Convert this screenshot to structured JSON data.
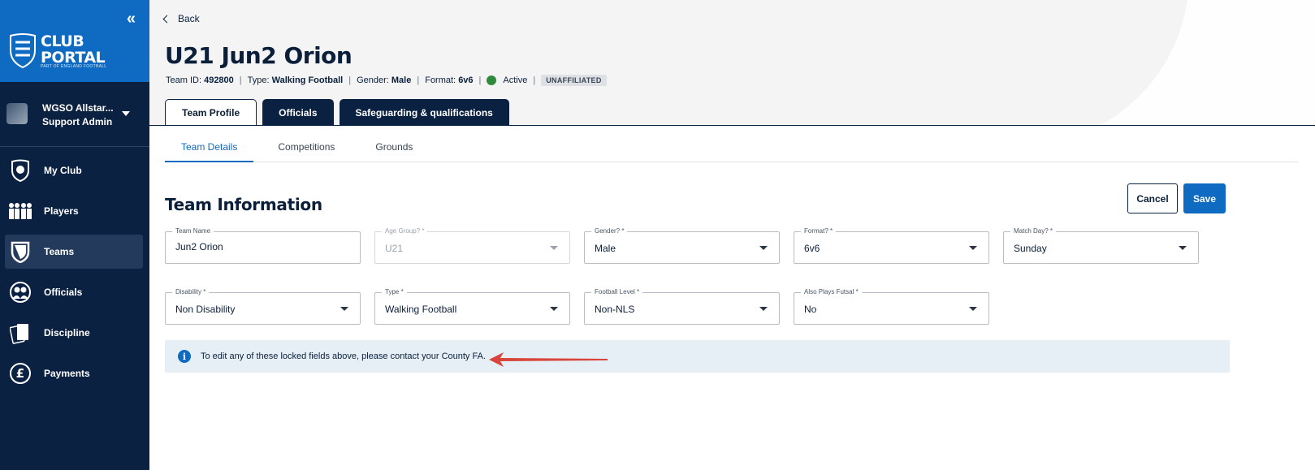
{
  "sidebar": {
    "collapse_icon": "double-chevron-left-icon",
    "brand": {
      "line1": "CLUB",
      "line2": "PORTAL",
      "sub": "PART OF ENGLAND FOOTBALL",
      "logo_icon": "three-lions-crest-icon"
    },
    "user": {
      "name": "WGSO Allstar...",
      "role": "Support Admin",
      "dropdown_icon": "caret-down-icon"
    },
    "nav": [
      {
        "label": "My Club",
        "icon": "club-badge-icon"
      },
      {
        "label": "Players",
        "icon": "players-group-icon"
      },
      {
        "label": "Teams",
        "icon": "shield-icon"
      },
      {
        "label": "Officials",
        "icon": "officials-icon"
      },
      {
        "label": "Discipline",
        "icon": "cards-icon"
      },
      {
        "label": "Payments",
        "icon": "pound-icon"
      }
    ],
    "active_nav": "Teams"
  },
  "header": {
    "back_label": "Back",
    "title": "U21 Jun2 Orion",
    "meta": {
      "team_id_label": "Team ID:",
      "team_id": "492800",
      "type_label": "Type:",
      "type": "Walking Football",
      "gender_label": "Gender:",
      "gender": "Male",
      "format_label": "Format:",
      "format": "6v6",
      "status": "Active",
      "status_color": "#2f8b3b",
      "affiliation": "UNAFFILIATED"
    },
    "tabs": [
      {
        "label": "Team Profile",
        "active": true
      },
      {
        "label": "Officials",
        "active": false
      },
      {
        "label": "Safeguarding & qualifications",
        "active": false
      }
    ]
  },
  "subtabs": [
    {
      "label": "Team Details",
      "active": true
    },
    {
      "label": "Competitions",
      "active": false
    },
    {
      "label": "Grounds",
      "active": false
    }
  ],
  "form": {
    "section_title": "Team Information",
    "cancel_label": "Cancel",
    "save_label": "Save",
    "fields": {
      "team_name": {
        "label": "Team Name",
        "value": "Jun2 Orion"
      },
      "age_group": {
        "label": "Age Group? *",
        "value": "U21"
      },
      "gender": {
        "label": "Gender? *",
        "value": "Male"
      },
      "format": {
        "label": "Format? *",
        "value": "6v6"
      },
      "match_day": {
        "label": "Match Day? *",
        "value": "Sunday"
      },
      "disability": {
        "label": "Disability *",
        "value": "Non Disability"
      },
      "type": {
        "label": "Type *",
        "value": "Walking Football"
      },
      "football_level": {
        "label": "Football Level *",
        "value": "Non-NLS"
      },
      "futsal": {
        "label": "Also Plays Futsal *",
        "value": "No"
      }
    },
    "info_text": "To edit any of these locked fields above, please contact your County FA."
  },
  "colors": {
    "sidebar": "#0b2141",
    "brand": "#0f6ac1",
    "accent": "#0f6ac1",
    "annotation_arrow": "#d9453b"
  }
}
